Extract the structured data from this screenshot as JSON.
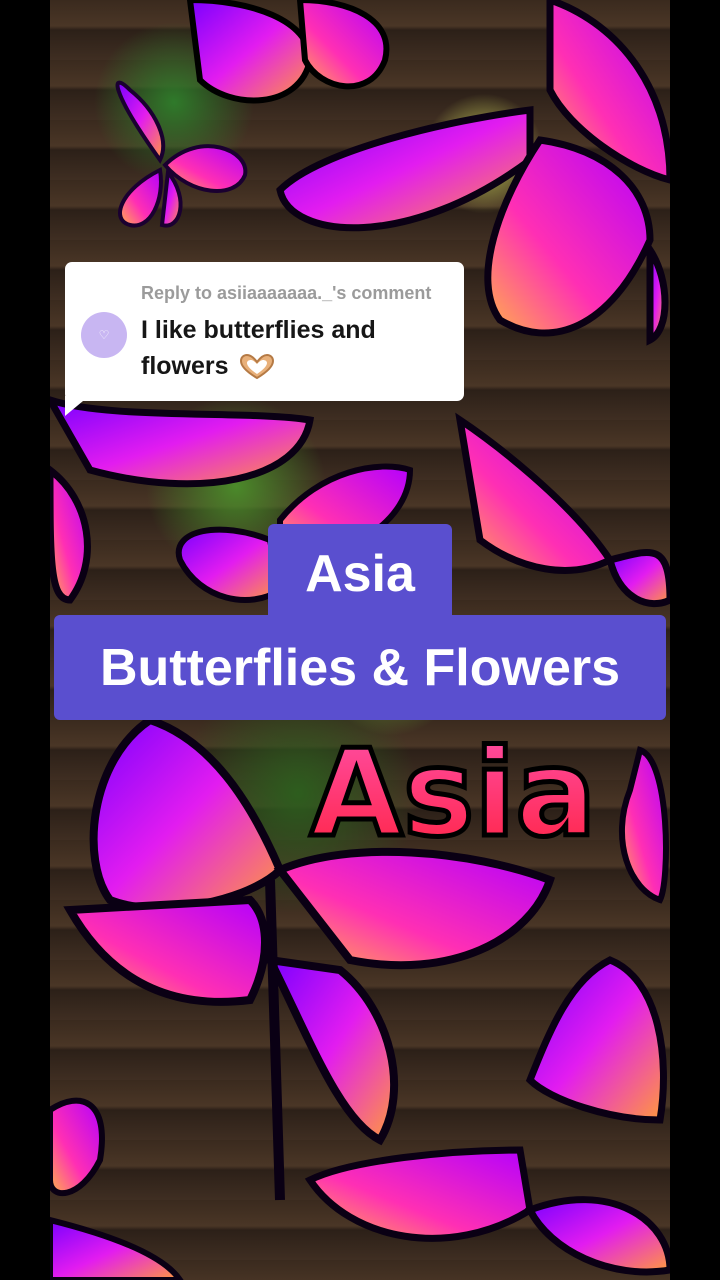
{
  "comment": {
    "reply_to": "Reply to asiiaaaaaaa._'s comment",
    "text": "I like butterflies and flowers",
    "emoji_icon": "heart-hands-icon"
  },
  "captions": {
    "line1": "Asia",
    "line2": "Butterflies & Flowers"
  },
  "background": {
    "overlay_text": "Asia",
    "colors": {
      "purple": "#b400ff",
      "pink": "#ff2f9a",
      "orange": "#ff9a3c",
      "caption_bg": "#5a4fcf"
    }
  }
}
